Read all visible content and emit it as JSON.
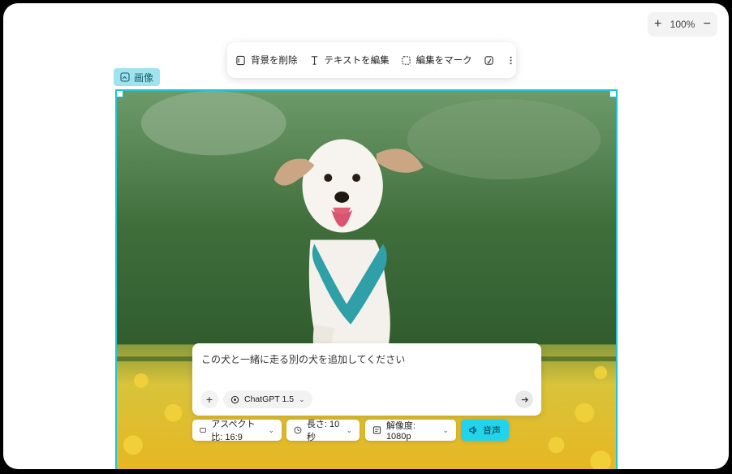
{
  "zoom": {
    "level": "100%",
    "zoom_in": "+",
    "zoom_out": "−"
  },
  "toolbar": {
    "remove_bg": "背景を削除",
    "edit_text": "テキストを編集",
    "mark_edit": "編集をマーク"
  },
  "image_label": "画像",
  "prompt": {
    "text": "この犬と一緒に走る別の犬を追加してください",
    "add": "+",
    "model": "ChatGPT 1.5"
  },
  "options": {
    "aspect": "アスペクト比: 16:9",
    "length": "長さ: 10秒",
    "resolution": "解像度: 1080p",
    "audio": "音声"
  },
  "colors": {
    "accent": "#22d3ee",
    "frame": "#1fc6d8"
  }
}
